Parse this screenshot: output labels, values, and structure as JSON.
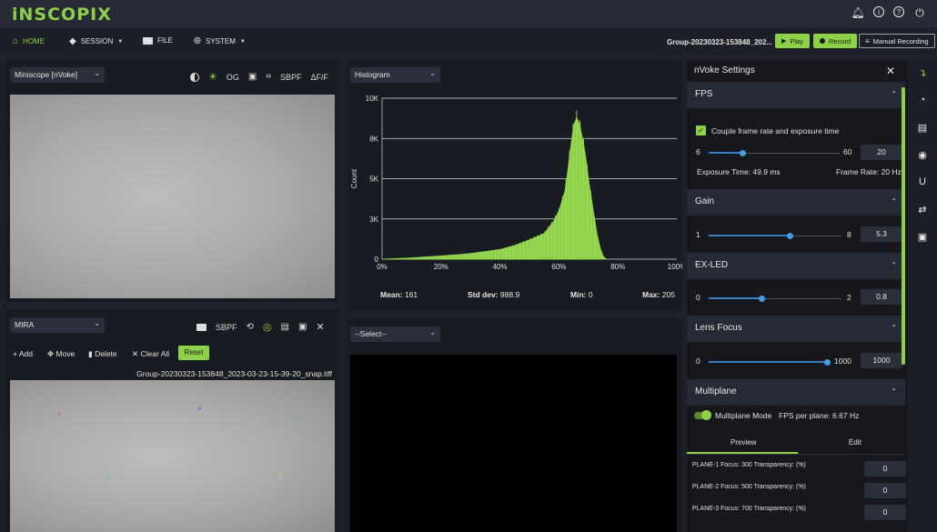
{
  "app": {
    "logo": "iNSCOPIX"
  },
  "nav": {
    "home": "HOME",
    "session": "SESSION",
    "file": "FILE",
    "system": "SYSTEM",
    "group_name": "Group-20230323-153848_202...",
    "play": "Play",
    "record": "Record",
    "manual_recording": "Manual Recording"
  },
  "viewer1": {
    "source": "Miniscope [nVoke]",
    "og": "OG",
    "sbpf": "SBPF",
    "dff": "ΔF/F"
  },
  "histogram": {
    "select": "Histogram",
    "ylabel": "Count",
    "yticks": [
      "10K",
      "8K",
      "5K",
      "3K",
      "0"
    ],
    "xticks": [
      "0%",
      "20%",
      "40%",
      "60%",
      "80%",
      "100%"
    ],
    "mean_label": "Mean:",
    "mean": "161",
    "std_label": "Std dev:",
    "std": "988.9",
    "min_label": "Min:",
    "min": "0",
    "max_label": "Max:",
    "max": "205"
  },
  "chart_data": {
    "type": "area",
    "ylabel": "Count",
    "xlim": [
      0,
      100
    ],
    "ylim": [
      0,
      10000
    ],
    "x": [
      0,
      10,
      20,
      30,
      40,
      45,
      50,
      55,
      58,
      60,
      62,
      63,
      64,
      65,
      66,
      67,
      68,
      69,
      70,
      71,
      72,
      73,
      74,
      75,
      76
    ],
    "y": [
      0,
      80,
      200,
      350,
      600,
      850,
      1200,
      1600,
      2300,
      3000,
      4200,
      5500,
      7000,
      8300,
      8800,
      8400,
      7500,
      6500,
      5000,
      3800,
      2600,
      1500,
      700,
      200,
      0
    ],
    "color": "#8dd04a",
    "grid": true
  },
  "mira": {
    "source": "MIRA",
    "sbpf": "SBPF",
    "add": "Add",
    "move": "Move",
    "delete": "Delete",
    "clear_all": "Clear All",
    "reset": "Reset",
    "filename": "Group-20230323-153848_2023-03-23-15-39-20_snap.tiff",
    "markers": [
      {
        "color": "#e04848"
      },
      {
        "color": "#4a5ae8"
      },
      {
        "color": "#5ac8c8"
      },
      {
        "color": "#58c858"
      },
      {
        "color": "#d8d84a"
      }
    ]
  },
  "viewer3": {
    "select": "--Select--"
  },
  "settings": {
    "title": "nVoke Settings",
    "fps": {
      "title": "FPS",
      "couple_label": "Couple frame rate and exposure time",
      "min": "6",
      "max": "60",
      "value": "20",
      "level": 0.26,
      "exposure": "Exposure Time: 49.9 ms",
      "frame_rate": "Frame Rate: 20 Hz"
    },
    "gain": {
      "title": "Gain",
      "min": "1",
      "max": "8",
      "value": "5.3",
      "level": 0.61
    },
    "exled": {
      "title": "EX-LED",
      "min": "0",
      "max": "2",
      "value": "0.8",
      "level": 0.4
    },
    "lens": {
      "title": "Lens Focus",
      "min": "0",
      "max": "1000",
      "value": "1000",
      "level": 1.0
    },
    "multiplane": {
      "title": "Multiplane",
      "mode_label": "Multiplane Mode",
      "fps_per_plane": "FPS per plane: 6.67 Hz",
      "tab_preview": "Preview",
      "tab_edit": "Edit",
      "planes": [
        {
          "label": "PLANE-1 Focus: 300 Transparency: (%)",
          "value": "0"
        },
        {
          "label": "PLANE-2 Focus: 500 Transparency: (%)",
          "value": "0"
        },
        {
          "label": "PLANE-3 Focus: 700 Transparency: (%)",
          "value": "0"
        }
      ]
    }
  }
}
